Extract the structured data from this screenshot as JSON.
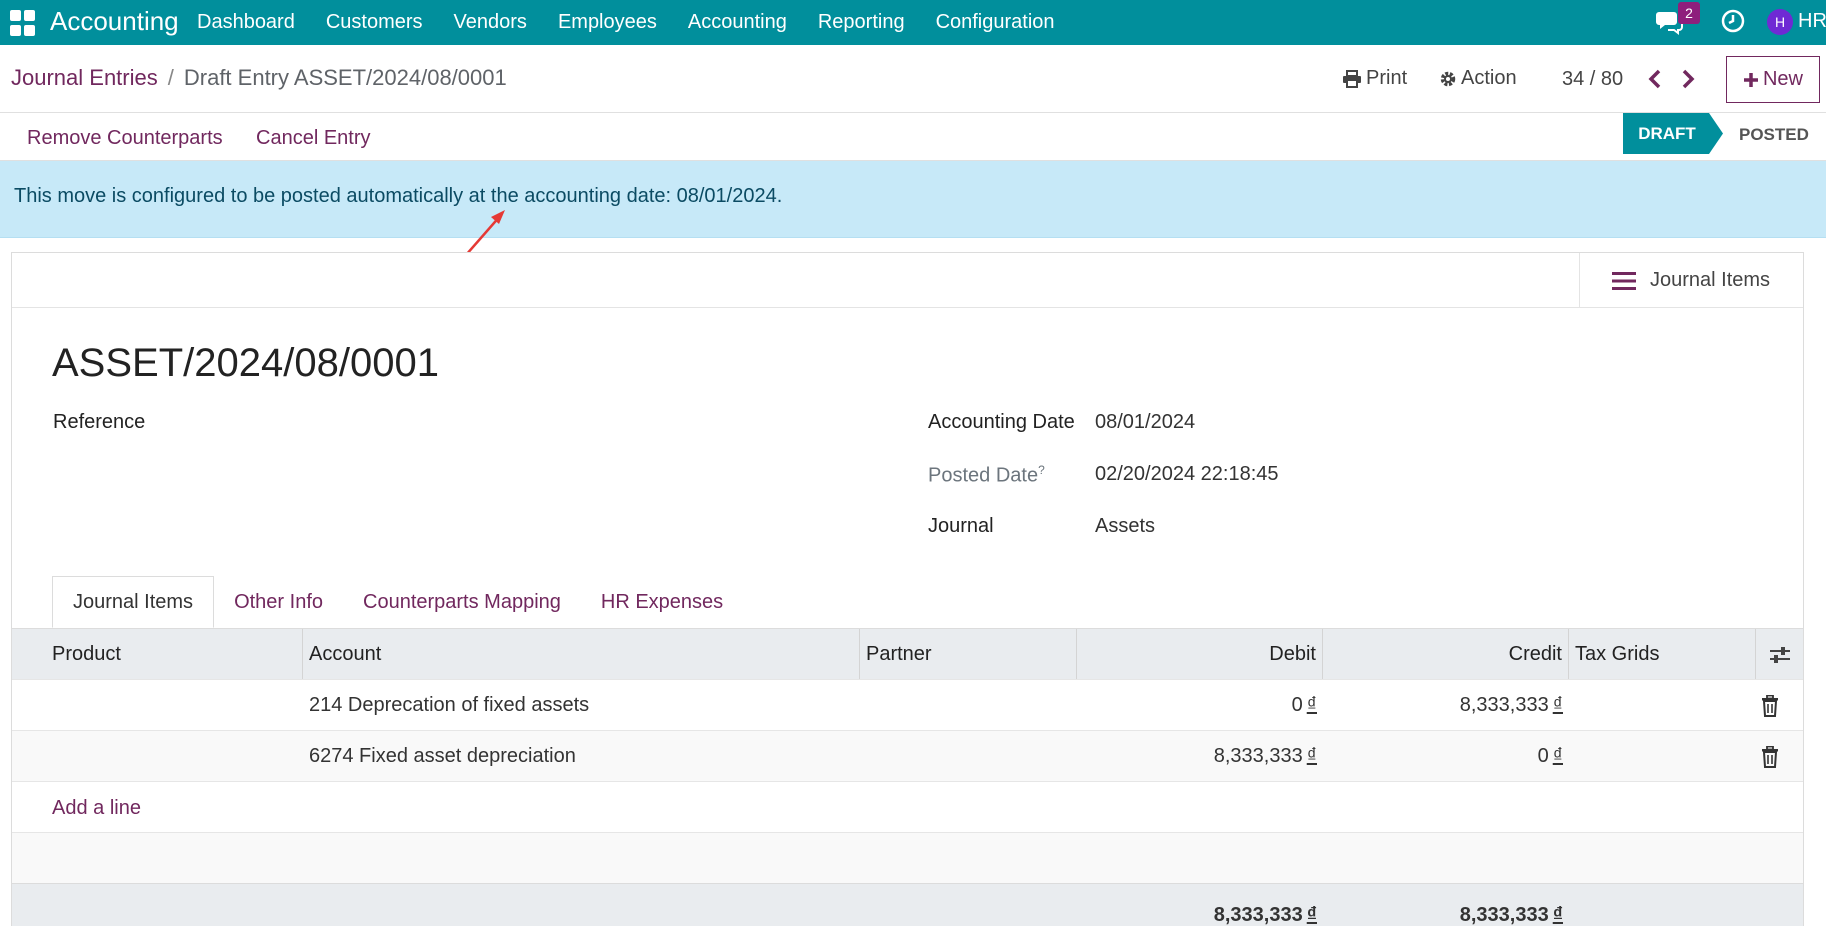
{
  "navbar": {
    "app_name": "Accounting",
    "menu": [
      "Dashboard",
      "Customers",
      "Vendors",
      "Employees",
      "Accounting",
      "Reporting",
      "Configuration"
    ],
    "chat_count": "2",
    "avatar_letter": "H",
    "user": "HR"
  },
  "control": {
    "breadcrumb_parent": "Journal Entries",
    "breadcrumb_sep": "/",
    "breadcrumb_current": "Draft Entry ASSET/2024/08/0001",
    "print_label": "Print",
    "action_label": "Action",
    "pager": "34 / 80",
    "new_label": "New"
  },
  "statusbar": {
    "buttons": [
      "Remove Counterparts",
      "Cancel Entry"
    ],
    "states": [
      "DRAFT",
      "POSTED"
    ],
    "active_state": "DRAFT"
  },
  "alert": {
    "text": "This move is configured to be posted automatically at the accounting date: 08/01/2024."
  },
  "sheet": {
    "smart_button": "Journal Items",
    "title": "ASSET/2024/08/0001",
    "reference_label": "Reference",
    "fields": [
      {
        "label": "Accounting Date",
        "value": "08/01/2024"
      },
      {
        "label": "Posted Date",
        "help": "?",
        "value": "02/20/2024 22:18:45"
      },
      {
        "label": "Journal",
        "value": "Assets"
      }
    ],
    "tabs": [
      "Journal Items",
      "Other Info",
      "Counterparts Mapping",
      "HR Expenses"
    ]
  },
  "table": {
    "columns": [
      "Product",
      "Account",
      "Partner",
      "Debit",
      "Credit",
      "Tax Grids"
    ],
    "rows": [
      {
        "product": "",
        "account": "214 Deprecation of fixed assets",
        "partner": "",
        "debit": "0",
        "credit": "8,333,333"
      },
      {
        "product": "",
        "account": "6274 Fixed asset depreciation",
        "partner": "",
        "debit": "8,333,333",
        "credit": "0"
      }
    ],
    "currency": "₫",
    "add_line": "Add a line",
    "total_debit": "8,333,333",
    "total_credit": "8,333,333"
  },
  "colors": {
    "primary": "#018f9c",
    "brand": "#71285e",
    "alert_bg": "#c7e9f8"
  }
}
